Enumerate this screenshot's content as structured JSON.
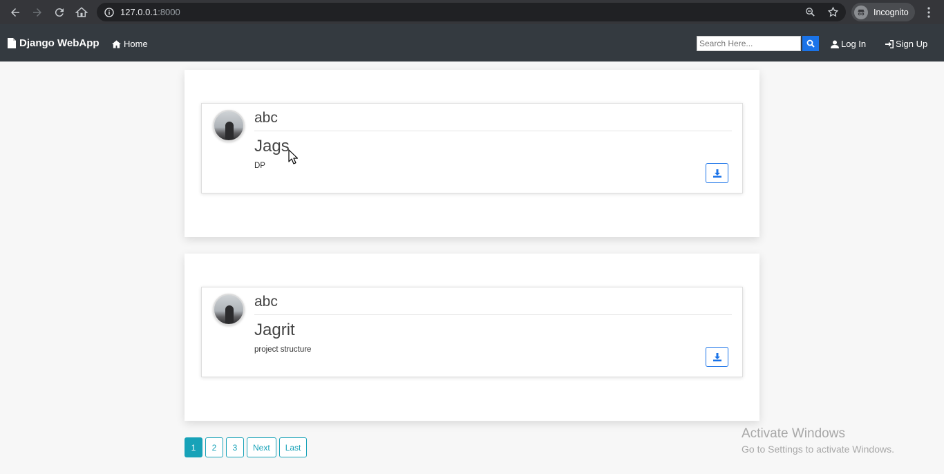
{
  "browser": {
    "url_host": "127.0.0.1",
    "url_port": ":8000",
    "incognito_label": "Incognito"
  },
  "navbar": {
    "brand": "Django WebApp",
    "home": "Home",
    "search_placeholder": "Search Here...",
    "login": "Log In",
    "signup": "Sign Up"
  },
  "posts": [
    {
      "author": "abc",
      "title": "Jags",
      "content": "DP"
    },
    {
      "author": "abc",
      "title": "Jagrit",
      "content": "project structure"
    }
  ],
  "pagination": {
    "pages": [
      "1",
      "2",
      "3"
    ],
    "next": "Next",
    "last": "Last",
    "active": "1"
  },
  "watermark": {
    "line1": "Activate Windows",
    "line2": "Go to Settings to activate Windows."
  },
  "colors": {
    "navbar": "#343a40",
    "primary": "#1a73e8",
    "info": "#17a2b8"
  }
}
